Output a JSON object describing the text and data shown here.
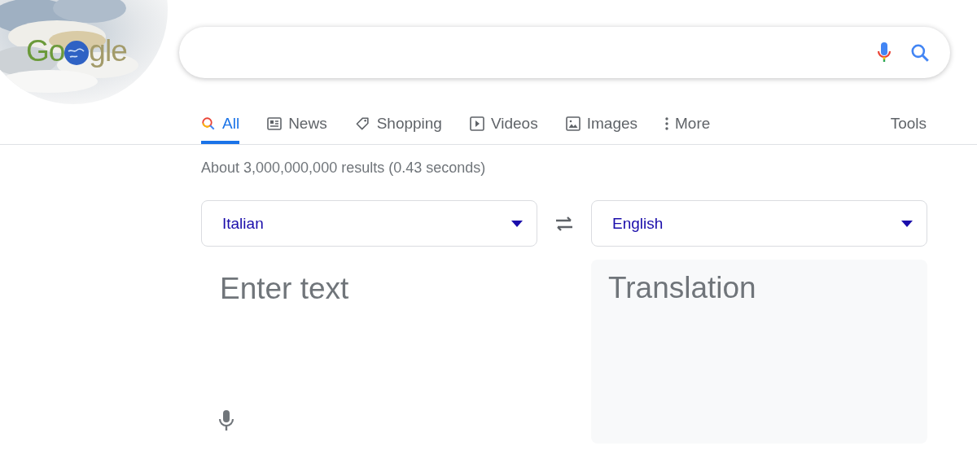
{
  "logo": {
    "before": "Go",
    "after": "gle"
  },
  "tabs": [
    {
      "label": "All",
      "selected": true
    },
    {
      "label": "News",
      "selected": false
    },
    {
      "label": "Shopping",
      "selected": false
    },
    {
      "label": "Videos",
      "selected": false
    },
    {
      "label": "Images",
      "selected": false
    },
    {
      "label": "More",
      "selected": false
    }
  ],
  "tools": "Tools",
  "result_stats": "About 3,000,000,000 results (0.43 seconds)",
  "translate": {
    "source_language": "Italian",
    "target_language": "English",
    "input_placeholder": "Enter text",
    "output_placeholder": "Translation"
  }
}
